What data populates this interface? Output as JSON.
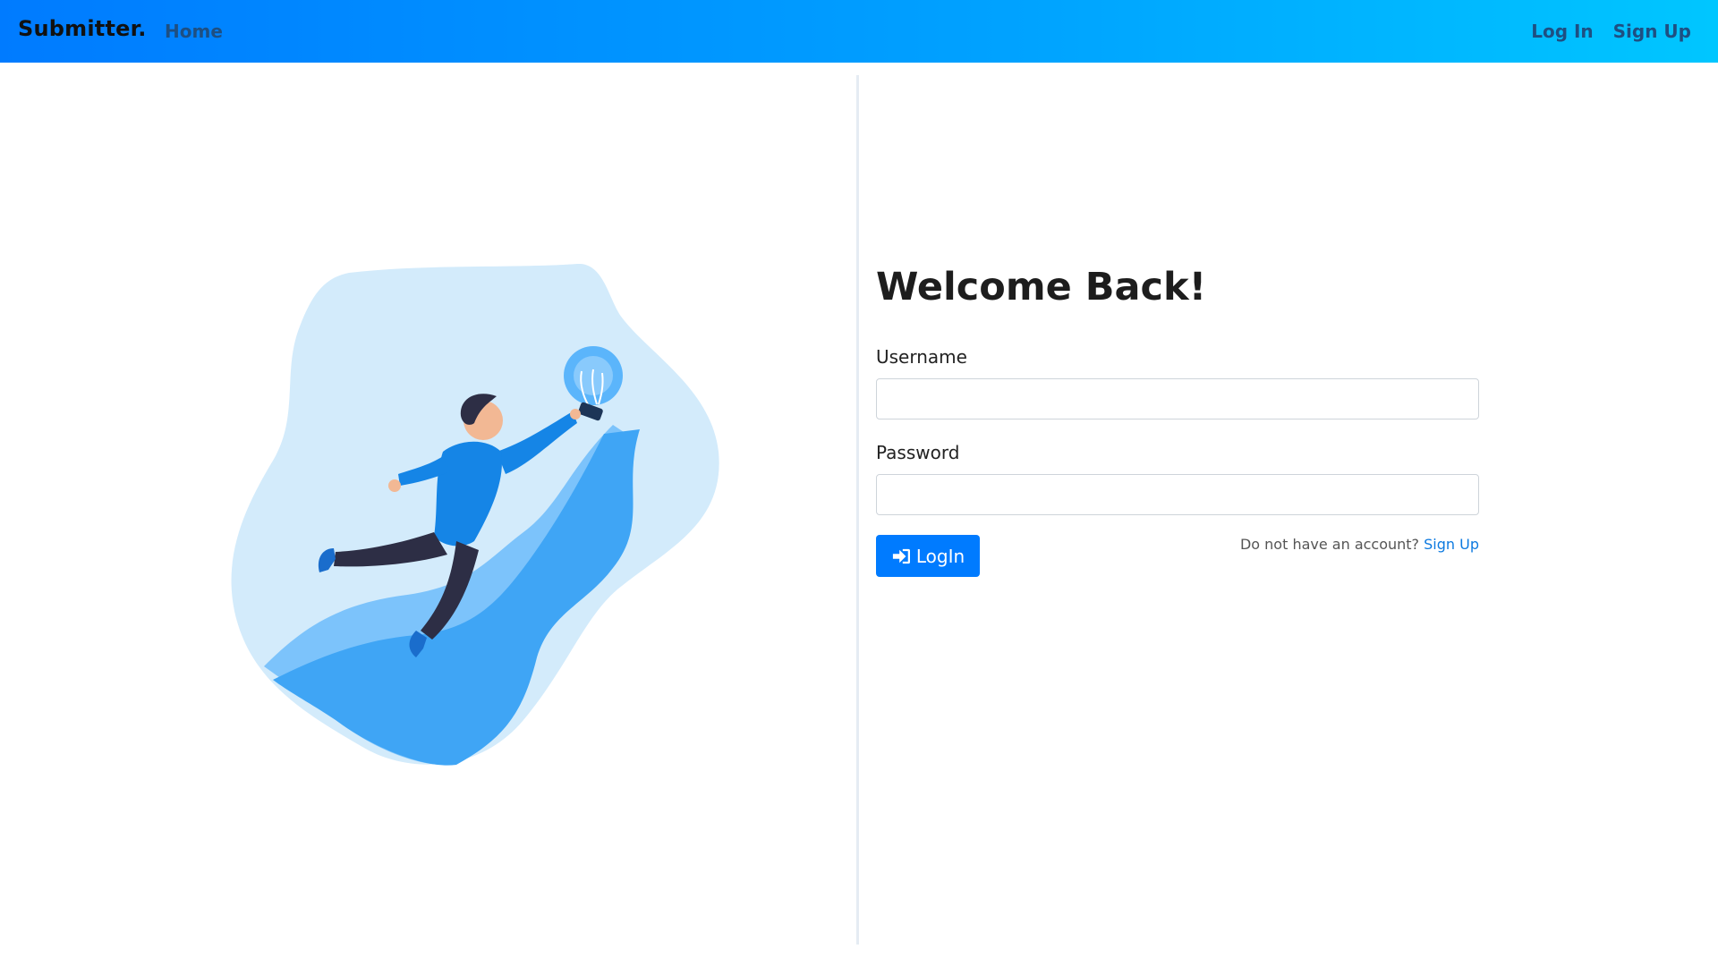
{
  "navbar": {
    "brand": "Submitter.",
    "home": "Home",
    "login": "Log In",
    "signup": "Sign Up"
  },
  "form": {
    "title": "Welcome Back!",
    "username_label": "Username",
    "username_value": "",
    "password_label": "Password",
    "password_value": "",
    "login_button": "LogIn",
    "signup_prompt": "Do not have an account?",
    "signup_link": "Sign Up"
  },
  "icons": {
    "login_button_icon": "sign-in-icon"
  },
  "colors": {
    "navbar_gradient_start": "#007bff",
    "navbar_gradient_end": "#00c6ff",
    "primary": "#007bff",
    "link": "#0d7ae0",
    "illustration_blob": "#d3ebfb"
  }
}
